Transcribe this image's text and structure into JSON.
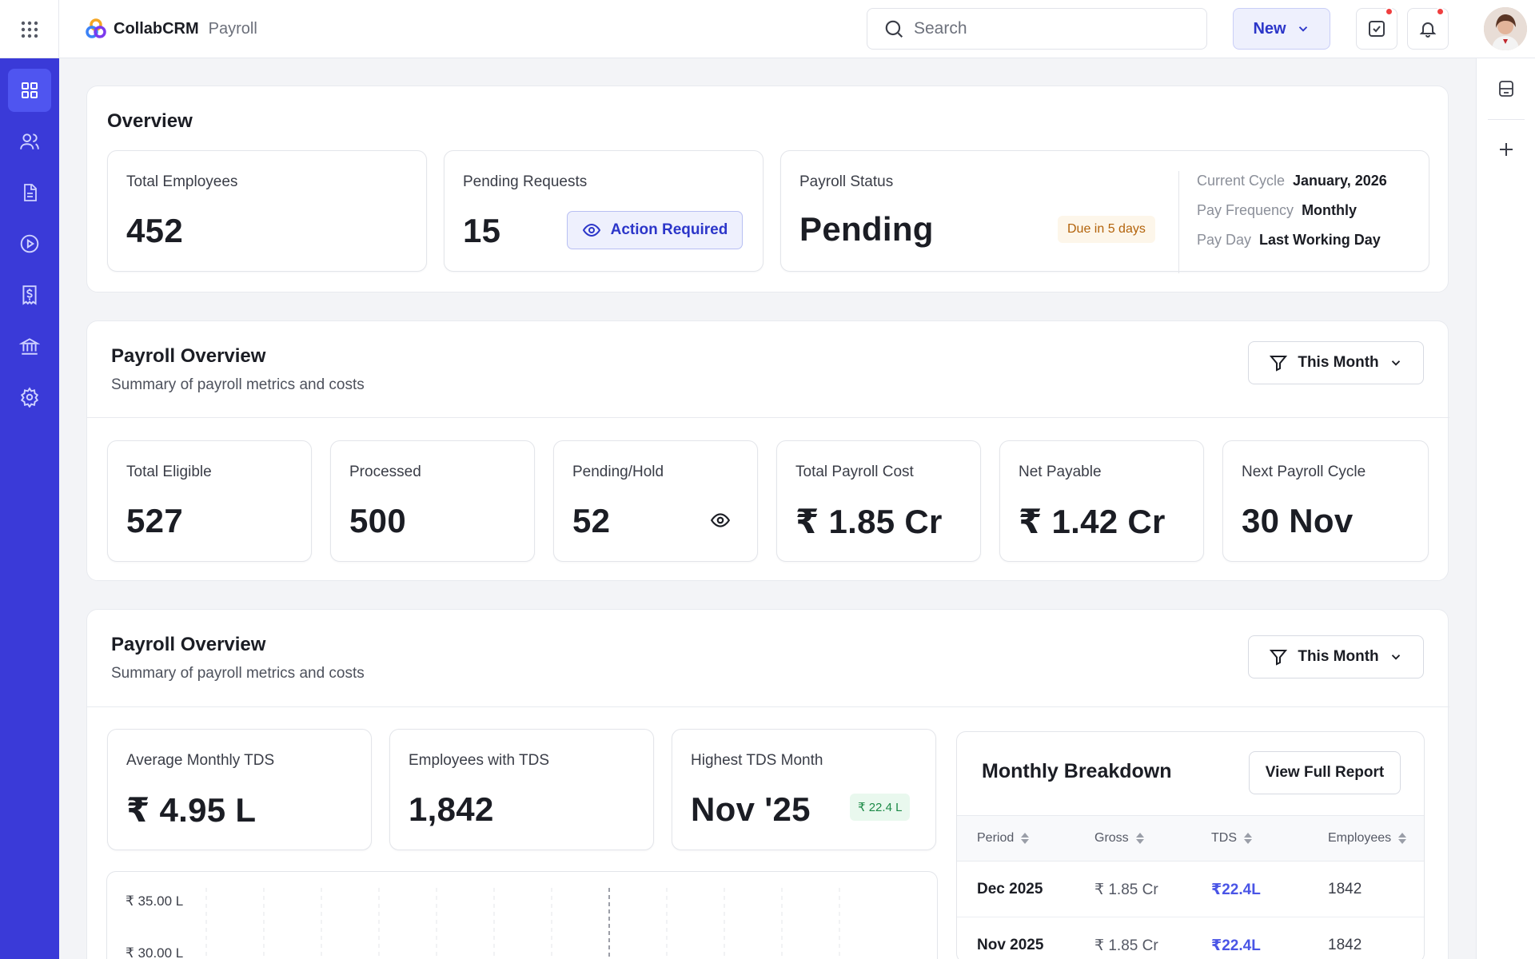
{
  "app": {
    "name": "CollabCRM",
    "module": "Payroll"
  },
  "search": {
    "placeholder": "Search"
  },
  "header": {
    "new_label": "New"
  },
  "colors": {
    "sidebar": "#3a3ad8",
    "accent": "#2c36c9",
    "notification": "#ef3f3f"
  },
  "sidebar": {
    "items": [
      {
        "icon": "dashboard-icon",
        "active": true
      },
      {
        "icon": "users-icon"
      },
      {
        "icon": "document-icon"
      },
      {
        "icon": "play-icon"
      },
      {
        "icon": "payment-receipt-icon"
      },
      {
        "icon": "bank-icon"
      },
      {
        "icon": "settings-icon"
      }
    ]
  },
  "rail": {
    "items": [
      "panel-icon",
      "add-icon"
    ]
  },
  "overview": {
    "title": "Overview",
    "total_employees": {
      "label": "Total Employees",
      "value": "452"
    },
    "pending_requests": {
      "label": "Pending Requests",
      "value": "15",
      "badge": "Action Required"
    },
    "payroll_status": {
      "label": "Payroll Status",
      "value": "Pending",
      "due": "Due in 5 days",
      "current_cycle_label": "Current Cycle",
      "current_cycle": "January, 2026",
      "pay_frequency_label": "Pay Frequency",
      "pay_frequency": "Monthly",
      "pay_day_label": "Pay Day",
      "pay_day": "Last Working Day"
    }
  },
  "payroll_overview": {
    "title": "Payroll Overview",
    "subtitle": "Summary of payroll metrics and costs",
    "filter": "This Month",
    "stats": [
      {
        "label": "Total Eligible",
        "value": "527"
      },
      {
        "label": "Processed",
        "value": "500"
      },
      {
        "label": "Pending/Hold",
        "value": "52"
      },
      {
        "label": "Total Payroll Cost",
        "value": "₹ 1.85 Cr"
      },
      {
        "label": "Net Payable",
        "value": "₹ 1.42 Cr"
      },
      {
        "label": "Next Payroll Cycle",
        "value": "30 Nov"
      }
    ]
  },
  "tds_overview": {
    "title": "Payroll Overview",
    "subtitle": "Summary of payroll metrics and costs",
    "filter": "This Month",
    "avg_tds": {
      "label": "Average Monthly TDS",
      "value": "₹ 4.95 L"
    },
    "employees_tds": {
      "label": "Employees with TDS",
      "value": "1,842"
    },
    "highest_tds": {
      "label": "Highest TDS Month",
      "value": "Nov '25",
      "badge": "₹ 22.4 L"
    },
    "chart_ticks": [
      "₹ 35.00 L",
      "₹ 30.00 L"
    ]
  },
  "breakdown": {
    "title": "Monthly Breakdown",
    "button": "View Full Report",
    "columns": [
      "Period",
      "Gross",
      "TDS",
      "Employees"
    ],
    "rows": [
      {
        "period": "Dec 2025",
        "gross": "₹ 1.85 Cr",
        "tds": "₹22.4L",
        "employees": "1842"
      },
      {
        "period": "Nov 2025",
        "gross": "₹ 1.85 Cr",
        "tds": "₹22.4L",
        "employees": "1842"
      }
    ]
  }
}
